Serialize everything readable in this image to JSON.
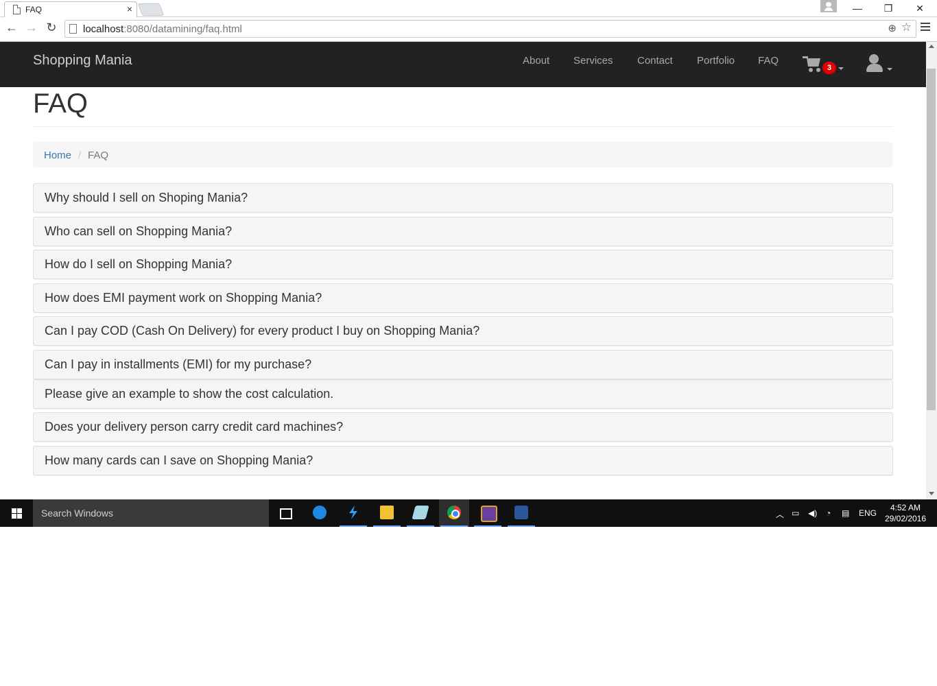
{
  "browser": {
    "tab_title": "FAQ",
    "tab_close": "×",
    "url_host": "localhost",
    "url_rest": ":8080/datamining/faq.html",
    "window_controls": {
      "minimize": "—",
      "restore": "❐",
      "close": "✕"
    },
    "nav": {
      "back": "←",
      "forward": "→",
      "reload": "↻"
    },
    "zoom_icon": "⊕",
    "star_icon": "☆"
  },
  "site": {
    "brand": "Shopping Mania",
    "nav": [
      {
        "label": "About"
      },
      {
        "label": "Services"
      },
      {
        "label": "Contact"
      },
      {
        "label": "Portfolio"
      },
      {
        "label": "FAQ"
      }
    ],
    "cart_count": "3",
    "page_title": "FAQ",
    "breadcrumb": {
      "home": "Home",
      "separator": "/",
      "current": "FAQ"
    },
    "faqs": [
      "Why should I sell on Shoping Mania?",
      "Who can sell on Shopping Mania?",
      "How do I sell on Shopping Mania?",
      "How does EMI payment work on Shopping Mania?",
      "Can I pay COD (Cash On Delivery) for every product I buy on Shopping Mania?",
      "Can I pay in installments (EMI) for my purchase?",
      "Please give an example to show the cost calculation.",
      "Does your delivery person carry credit card machines?",
      "How many cards can I save on Shopping Mania?"
    ]
  },
  "taskbar": {
    "search_placeholder": "Search Windows",
    "language": "ENG",
    "time": "4:52 AM",
    "date": "29/02/2016",
    "apps": [
      "task-view",
      "edge",
      "lightning-app",
      "file-explorer",
      "notes-app",
      "chrome",
      "media-app",
      "word"
    ]
  },
  "colors": {
    "navbar_bg": "#222222",
    "link": "#337ab7",
    "badge": "#e00000",
    "taskbar_bg": "#101010"
  }
}
